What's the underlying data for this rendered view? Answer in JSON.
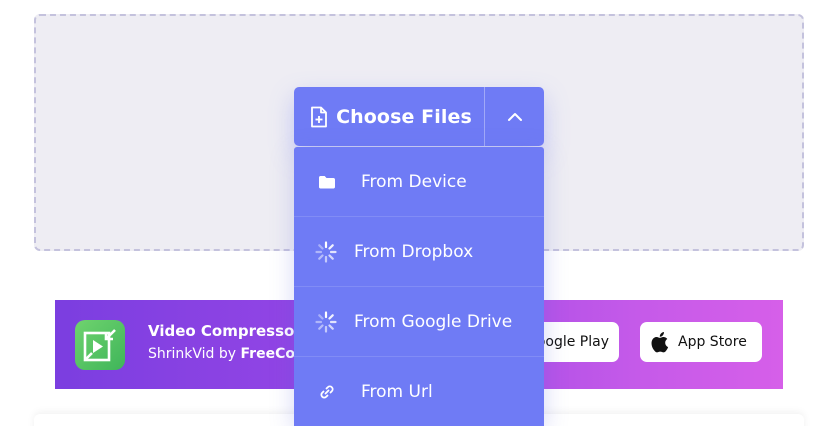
{
  "upload": {
    "choose_label": "Choose Files",
    "menu": [
      {
        "label": "From Device",
        "icon": "folder-icon"
      },
      {
        "label": "From Dropbox",
        "icon": "spinner-icon"
      },
      {
        "label": "From Google Drive",
        "icon": "spinner-icon"
      },
      {
        "label": "From Url",
        "icon": "link-icon"
      }
    ]
  },
  "banner": {
    "title": "Video Compressor A",
    "subtitle_prefix": "ShrinkVid by ",
    "subtitle_brand": "FreeCo",
    "google_play_label": "oogle Play",
    "app_store_label": "App Store"
  },
  "colors": {
    "accent": "#6f7bf5",
    "dropzone_bg": "#eeedf3",
    "dropzone_border": "#c4c2dd",
    "banner_start": "#7b3ee0",
    "banner_end": "#d65fe9",
    "app_icon": "#4cc060"
  }
}
